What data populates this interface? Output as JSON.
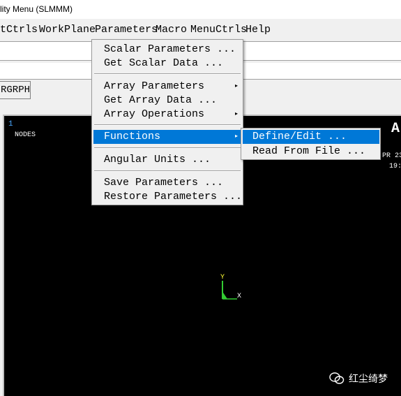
{
  "window": {
    "title": "lity Menu (SLMMM)"
  },
  "menubar": [
    {
      "label": "tCtrls"
    },
    {
      "label": "WorkPlane"
    },
    {
      "label": "Parameters"
    },
    {
      "label": "Macro"
    },
    {
      "label": "MenuCtrls"
    },
    {
      "label": "Help"
    }
  ],
  "toolbar": {
    "button_label": "RGRPH"
  },
  "parameters_menu": {
    "items": [
      {
        "label": "Scalar Parameters  ..."
      },
      {
        "label": "Get Scalar Data  ..."
      },
      {
        "label": "Array Parameters",
        "arrow": "▸"
      },
      {
        "label": "Get Array Data   ..."
      },
      {
        "label": "Array Operations",
        "arrow": "▸"
      },
      {
        "label": "Functions",
        "arrow": "▸",
        "highlighted": true
      },
      {
        "label": "Angular Units     ..."
      },
      {
        "label": "Save Parameters   ..."
      },
      {
        "label": "Restore Parameters  ..."
      }
    ]
  },
  "functions_submenu": {
    "items": [
      {
        "label": "Define/Edit      ...",
        "highlighted": true
      },
      {
        "label": "Read From File     ..."
      }
    ]
  },
  "graphics": {
    "window_number": "1",
    "label": "NODES",
    "logo_letter": "A",
    "date_line1": "PR 23",
    "date_line2": "19:",
    "axis_y": "Y",
    "axis_x": "X",
    "watermark": "红尘绮梦",
    "triad_color": "#33cc33"
  },
  "colors": {
    "highlight": "#0078d7",
    "background": "#000000"
  }
}
